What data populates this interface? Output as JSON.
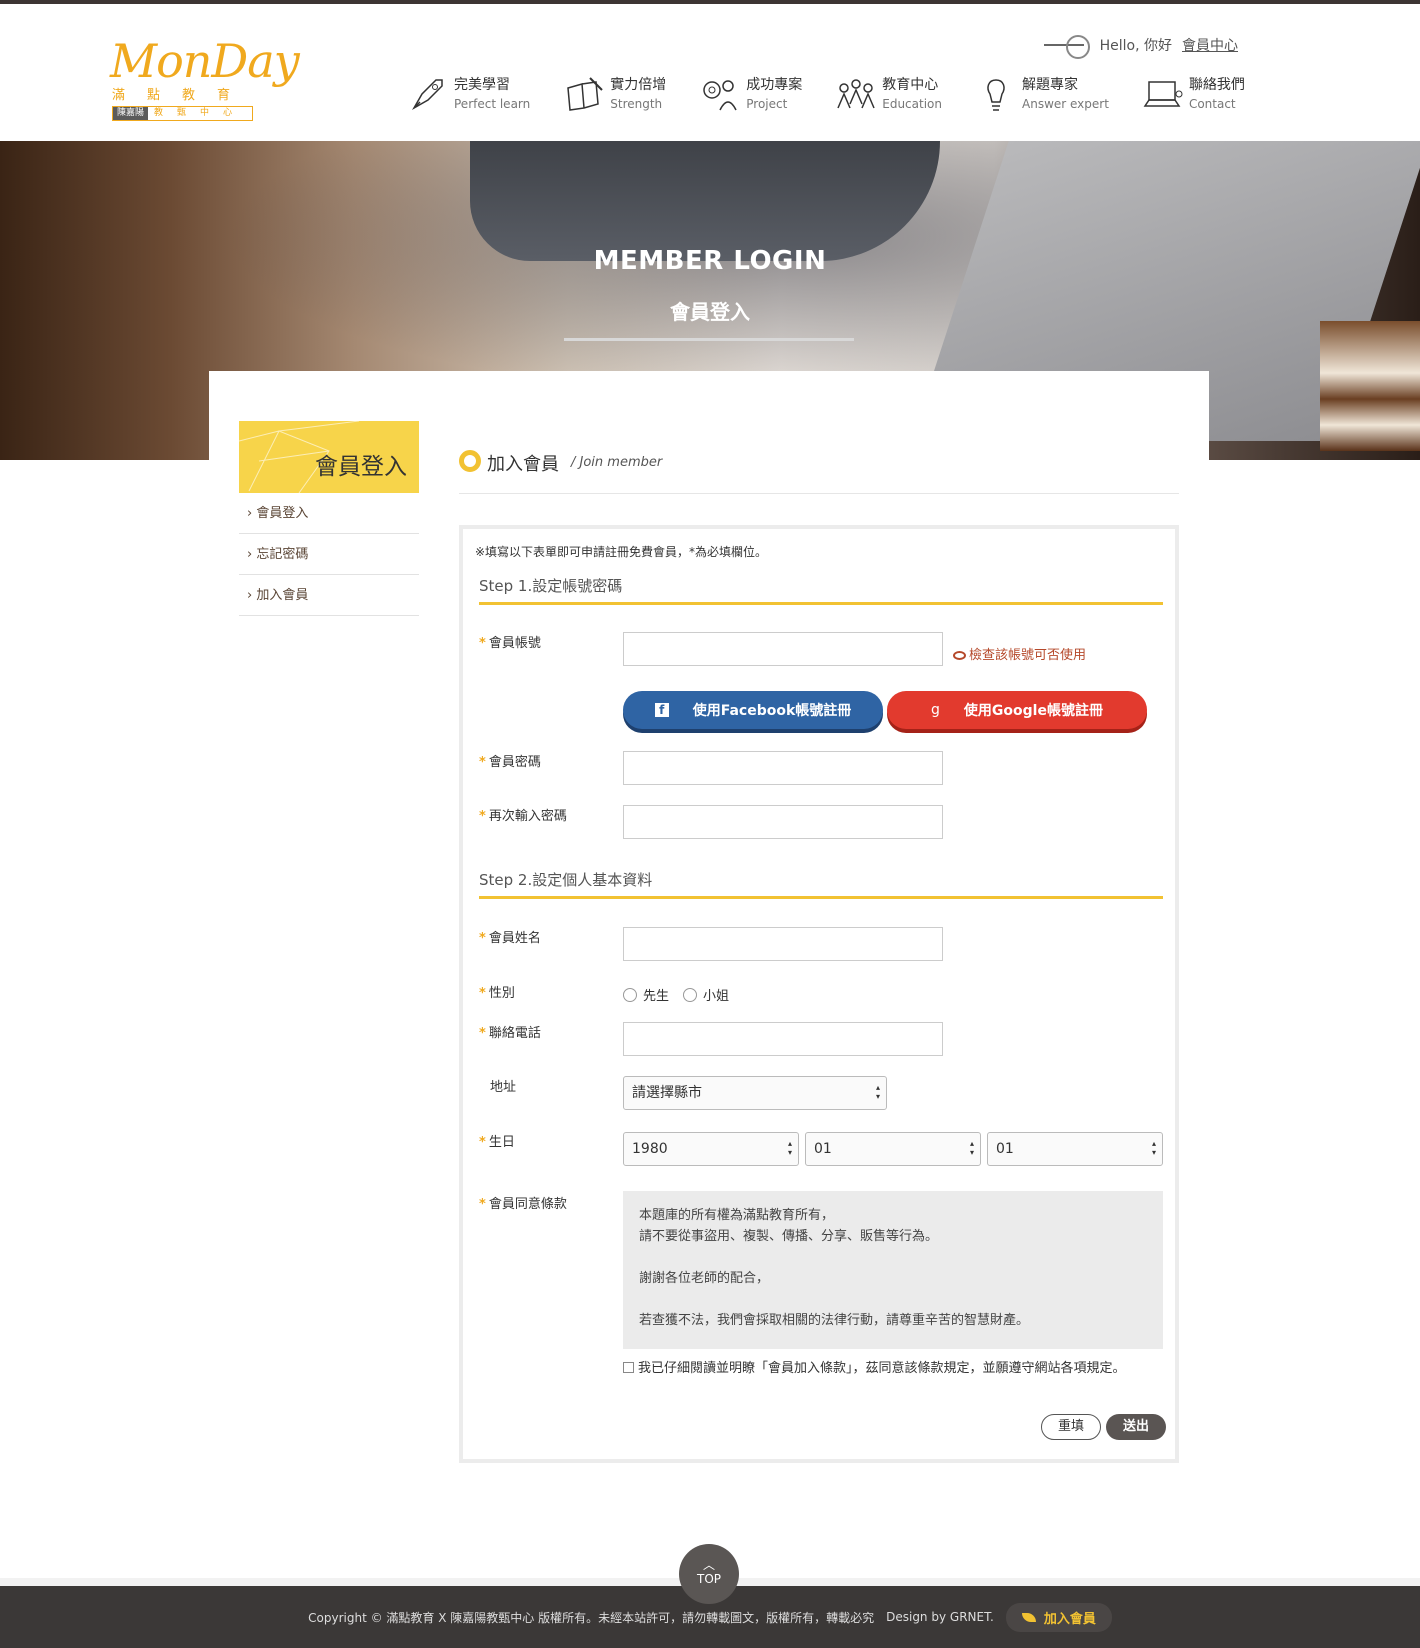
{
  "header": {
    "logo_text": "MonDay",
    "logo_sub": "滿點教育",
    "logo_bar_dark": "陳嘉陽",
    "logo_bar_light": "教甄中心",
    "hello": "Hello, 你好",
    "member_center": "會員中心",
    "nav": [
      {
        "zh": "完美學習",
        "en": "Perfect learn",
        "icon": "rocket-icon"
      },
      {
        "zh": "實力倍增",
        "en": "Strength",
        "icon": "book-pencil-icon"
      },
      {
        "zh": "成功專案",
        "en": "Project",
        "icon": "teacher-icon"
      },
      {
        "zh": "教育中心",
        "en": "Education",
        "icon": "people-icon"
      },
      {
        "zh": "解題專家",
        "en": "Answer expert",
        "icon": "lightbulb-icon"
      },
      {
        "zh": "聯絡我們",
        "en": "Contact",
        "icon": "laptop-icon"
      }
    ]
  },
  "banner": {
    "title": "MEMBER LOGIN",
    "subtitle": "會員登入"
  },
  "sidebar": {
    "title": "會員登入",
    "items": [
      {
        "label": "› 會員登入"
      },
      {
        "label": "› 忘記密碼"
      },
      {
        "label": "› 加入會員"
      }
    ]
  },
  "main": {
    "title": "加入會員",
    "title_en": "/ Join member"
  },
  "form": {
    "notice": "※填寫以下表單即可申請註冊免費會員，*為必填欄位。",
    "step1": "Step 1.設定帳號密碼",
    "step2": "Step 2.設定個人基本資料",
    "account_label": "會員帳號",
    "check_link": "檢查該帳號可否使用",
    "fb_button": "使用Facebook帳號註冊",
    "google_button": "使用Google帳號註冊",
    "password_label": "會員密碼",
    "password2_label": "再次輸入密碼",
    "name_label": "會員姓名",
    "gender_label": "性別",
    "gender_male": "先生",
    "gender_female": "小姐",
    "phone_label": "聯絡電話",
    "address_label": "地址",
    "address_select": "請選擇縣市",
    "birthday_label": "生日",
    "birth_year": "1980",
    "birth_month": "01",
    "birth_day": "01",
    "terms_label": "會員同意條款",
    "terms_line1": "本題庫的所有權為滿點教育所有，",
    "terms_line2": "請不要從事盜用、複製、傳播、分享、販售等行為。",
    "terms_line3": "謝謝各位老師的配合，",
    "terms_line4": "若查獲不法，我們會採取相關的法律行動，請尊重辛苦的智慧財產。",
    "agree_text": "我已仔細閱讀並明瞭「會員加入條款」，茲同意該條款規定，並願遵守網站各項規定。",
    "reset_button": "重填",
    "submit_button": "送出"
  },
  "footer": {
    "top_label": "TOP",
    "copyright": "Copyright © 滿點教育 X 陳嘉陽教甄中心 版權所有。未經本站許可，請勿轉載圖文，版權所有，轉載必究",
    "design": "Design by GRNET.",
    "join": "加入會員"
  },
  "colors": {
    "accent": "#f2c232",
    "brand_orange": "#f0a91e",
    "facebook": "#2f64a4",
    "google": "#e23a2e",
    "footer_bg": "#3b3837"
  }
}
